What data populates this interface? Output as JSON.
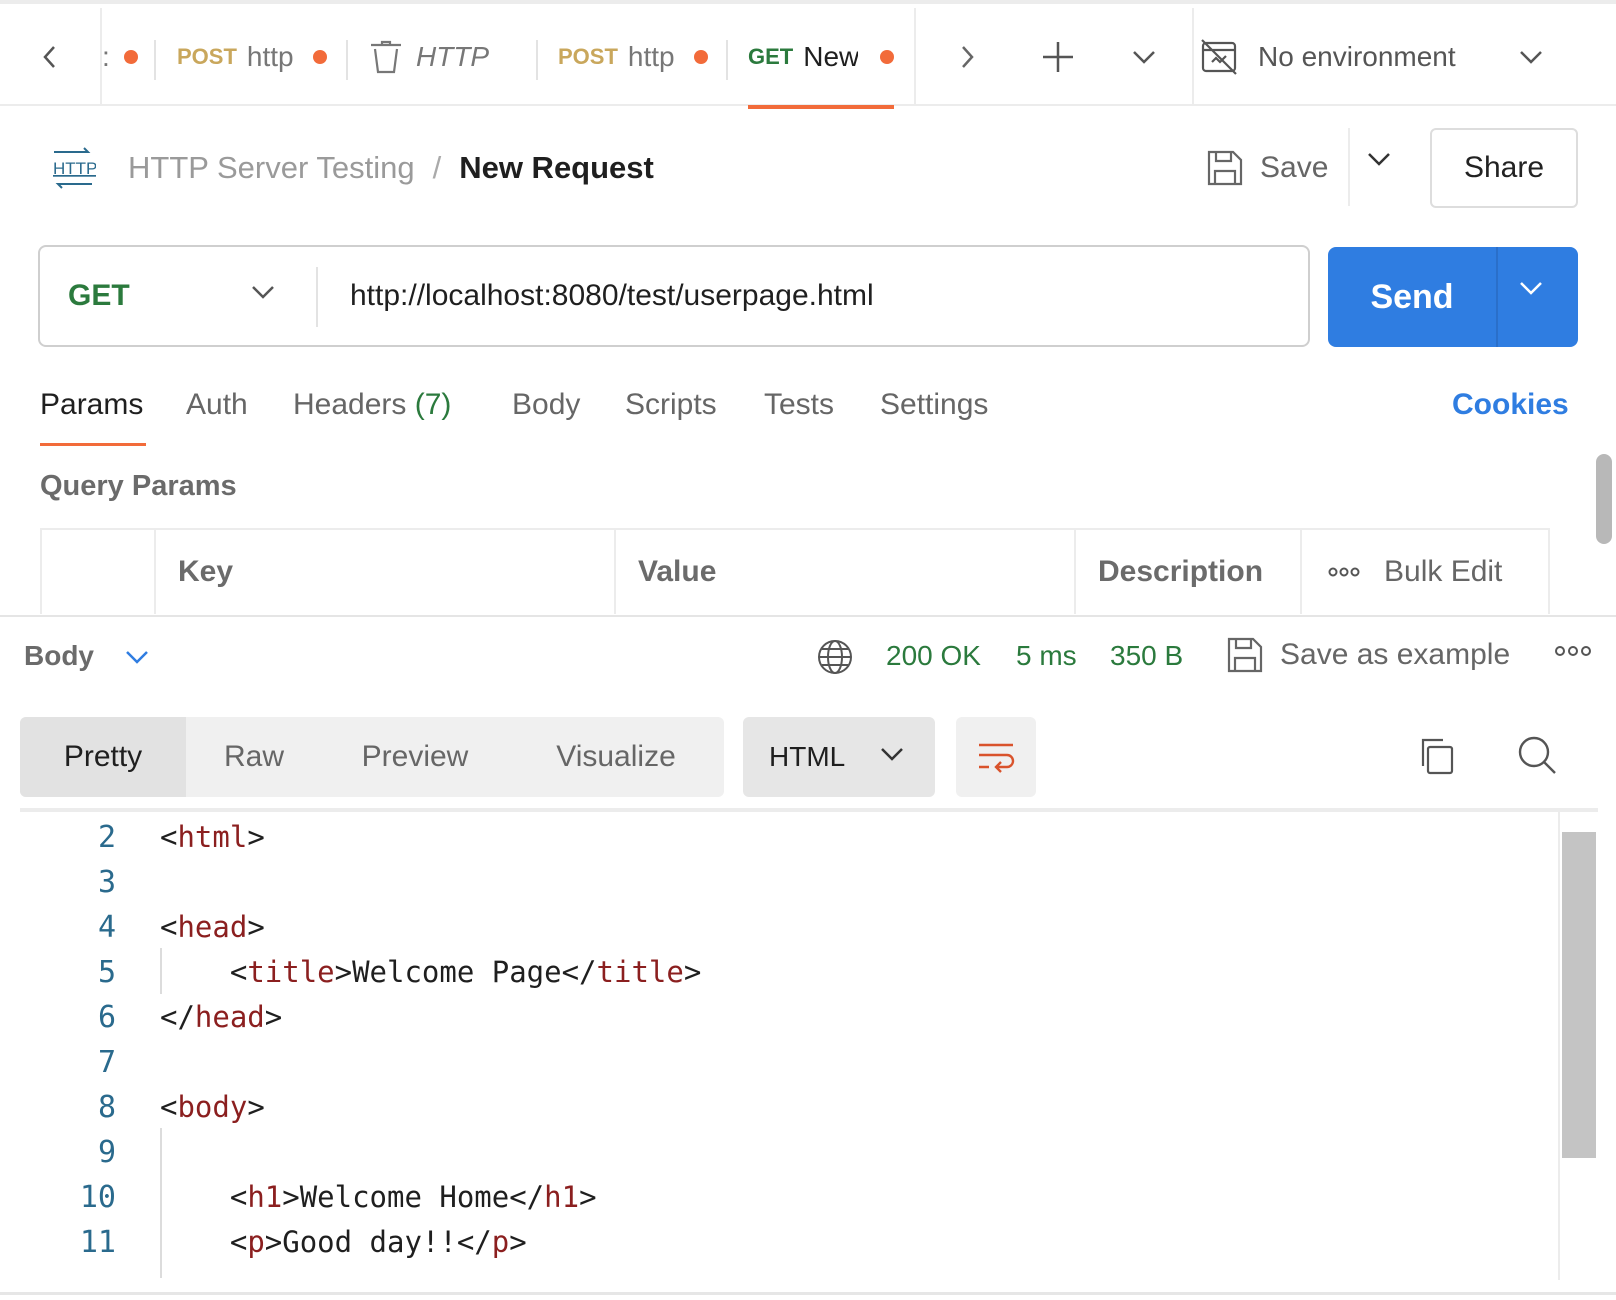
{
  "tabs": [
    {
      "method": "",
      "title": ":",
      "unsaved": true
    },
    {
      "method": "POST",
      "title": "http",
      "unsaved": true
    },
    {
      "method": "",
      "title": "HTTP",
      "unsaved": false
    },
    {
      "method": "POST",
      "title": "http",
      "unsaved": true
    },
    {
      "method": "GET",
      "title": "New",
      "unsaved": true,
      "active": true
    }
  ],
  "environment": {
    "label": "No environment"
  },
  "breadcrumb": {
    "icon_text": "HTTP",
    "collection": "HTTP Server Testing",
    "separator": "/",
    "request": "New Request"
  },
  "actions": {
    "save_label": "Save",
    "share_label": "Share"
  },
  "request": {
    "method": "GET",
    "url": "http://localhost:8080/test/userpage.html",
    "send_label": "Send"
  },
  "request_tabs": {
    "params": "Params",
    "auth": "Auth",
    "headers": "Headers",
    "headers_count": "(7)",
    "body": "Body",
    "scripts": "Scripts",
    "tests": "Tests",
    "settings": "Settings",
    "cookies": "Cookies"
  },
  "query_params": {
    "title": "Query Params",
    "columns": {
      "key": "Key",
      "value": "Value",
      "description": "Description"
    },
    "bulk_edit": "Bulk Edit"
  },
  "response": {
    "body_label": "Body",
    "status": "200 OK",
    "time": "5 ms",
    "size": "350 B",
    "save_example": "Save as example",
    "formats": {
      "pretty": "Pretty",
      "raw": "Raw",
      "preview": "Preview",
      "visualize": "Visualize"
    },
    "language": "HTML"
  },
  "code_lines": [
    {
      "n": "2",
      "text": "<html>"
    },
    {
      "n": "3",
      "text": ""
    },
    {
      "n": "4",
      "text": "<head>"
    },
    {
      "n": "5",
      "text": "    <title>Welcome Page</title>"
    },
    {
      "n": "6",
      "text": "</head>"
    },
    {
      "n": "7",
      "text": ""
    },
    {
      "n": "8",
      "text": "<body>"
    },
    {
      "n": "9",
      "text": ""
    },
    {
      "n": "10",
      "text": "    <h1>Welcome Home</h1>"
    },
    {
      "n": "11",
      "text": "    <p>Good day!!</p>"
    }
  ],
  "colors": {
    "accent_orange": "#f26b3a",
    "send_blue": "#2f7de1",
    "get_green": "#2b7a3d",
    "post_gold": "#c9a75c",
    "tag_red": "#8b1f1f"
  },
  "icons": [
    "chevron-left-icon",
    "chevron-right-icon",
    "plus-icon",
    "chevron-down-icon",
    "no-environment-icon",
    "http-icon",
    "save-icon",
    "globe-icon",
    "more-icon",
    "wrap-icon",
    "copy-icon",
    "search-icon",
    "trash-icon"
  ]
}
